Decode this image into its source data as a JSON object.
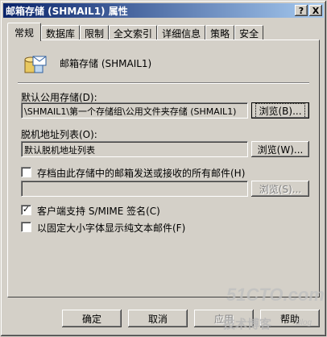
{
  "window": {
    "title": "邮箱存储 (SHMAIL1) 属性",
    "help_button": "?",
    "close_button": "X"
  },
  "tabs": [
    "常规",
    "数据库",
    "限制",
    "全文索引",
    "详细信息",
    "策略",
    "安全"
  ],
  "general": {
    "store_name": "邮箱存储 (SHMAIL1)",
    "public_store_label": "默认公用存储(D):",
    "public_store_value": "\\SHMAIL1\\第一个存储组\\公用文件夹存储 (SHMAIL1)",
    "browse_public": "浏览(B)...",
    "offline_label": "脱机地址列表(O):",
    "offline_value": "默认脱机地址列表",
    "browse_offline": "浏览(W)...",
    "archive_label": "存档由此存储中的邮箱发送或接收的所有邮件(H)",
    "archive_checked": false,
    "archive_value": "",
    "browse_archive": "浏览(S)...",
    "smime_label": "客户端支持 S/MIME 签名(C)",
    "smime_checked": true,
    "fixed_font_label": "以固定大小字体显示纯文本邮件(F)",
    "fixed_font_checked": false
  },
  "footer": {
    "ok": "确定",
    "cancel": "取消",
    "apply": "应用",
    "help": "帮助"
  },
  "watermark": {
    "site": "51CTO.com",
    "text": "技术博客",
    "blog": "Blog"
  }
}
